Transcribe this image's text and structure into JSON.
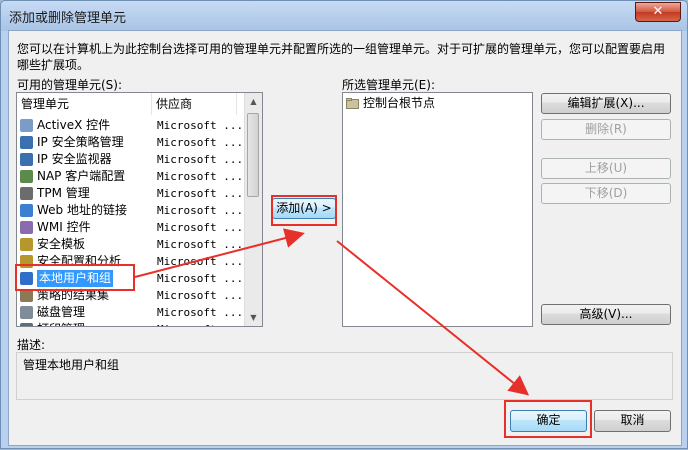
{
  "window": {
    "title": "添加或删除管理单元",
    "close_glyph": "✕"
  },
  "intro_text": "您可以在计算机上为此控制台选择可用的管理单元并配置所选的一组管理单元。对于可扩展的管理单元，您可以配置要启用哪些扩展项。",
  "available": {
    "label": "可用的管理单元(S):",
    "col_name": "管理单元",
    "col_vendor": "供应商",
    "items": [
      {
        "name": "ActiveX 控件",
        "vendor": "Microsoft ...",
        "icon": "activex-icon"
      },
      {
        "name": "IP 安全策略管理",
        "vendor": "Microsoft ...",
        "icon": "ip-security-icon"
      },
      {
        "name": "IP 安全监视器",
        "vendor": "Microsoft ...",
        "icon": "ip-monitor-icon"
      },
      {
        "name": "NAP 客户端配置",
        "vendor": "Microsoft ...",
        "icon": "nap-icon"
      },
      {
        "name": "TPM 管理",
        "vendor": "Microsoft ...",
        "icon": "tpm-icon"
      },
      {
        "name": "Web 地址的链接",
        "vendor": "Microsoft ...",
        "icon": "web-link-icon"
      },
      {
        "name": "WMI 控件",
        "vendor": "Microsoft ...",
        "icon": "wmi-icon"
      },
      {
        "name": "安全模板",
        "vendor": "Microsoft ...",
        "icon": "security-template-icon"
      },
      {
        "name": "安全配置和分析",
        "vendor": "Microsoft ...",
        "icon": "security-analysis-icon"
      },
      {
        "name": "本地用户和组",
        "vendor": "Microsoft ...",
        "icon": "users-icon"
      },
      {
        "name": "策略的结果集",
        "vendor": "Microsoft ...",
        "icon": "policy-icon"
      },
      {
        "name": "磁盘管理",
        "vendor": "Microsoft ...",
        "icon": "disk-icon"
      },
      {
        "name": "打印管理",
        "vendor": "Microsoft ...",
        "icon": "print-icon"
      }
    ],
    "selected_index": 9
  },
  "add_button": "添加(A) >",
  "selected": {
    "label": "所选管理单元(E):",
    "root": "控制台根节点"
  },
  "side_buttons": {
    "edit_ext": "编辑扩展(X)...",
    "remove": "删除(R)",
    "move_up": "上移(U)",
    "move_down": "下移(D)",
    "advanced": "高级(V)..."
  },
  "description": {
    "label": "描述:",
    "text": "管理本地用户和组"
  },
  "footer": {
    "ok": "确定",
    "cancel": "取消"
  },
  "colors": {
    "highlight": "#e8302a",
    "selection": "#3399ff",
    "accent": "#3c7fb1"
  }
}
